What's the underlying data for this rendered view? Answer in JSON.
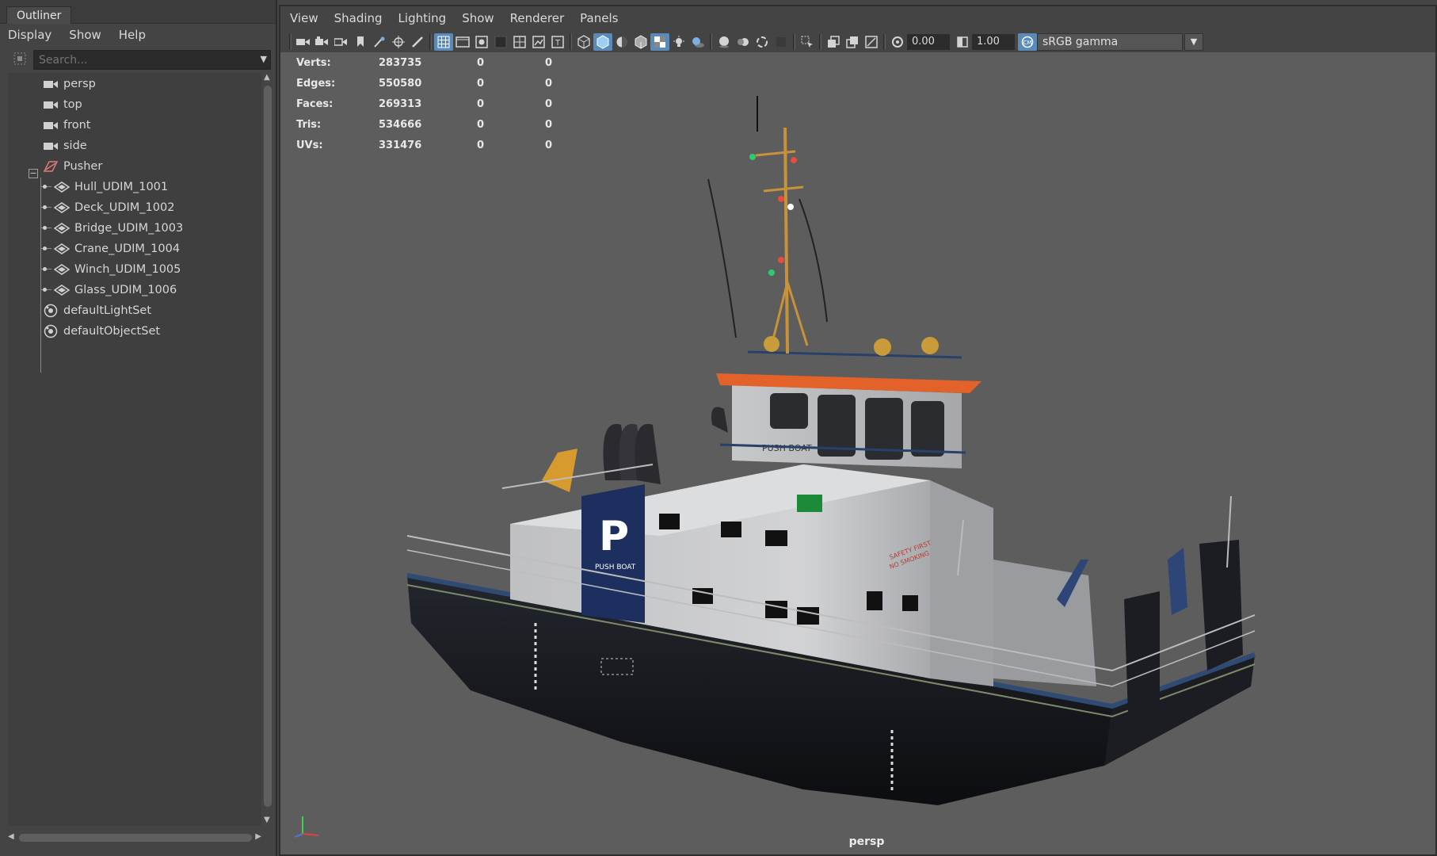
{
  "outliner": {
    "tab_title": "Outliner",
    "menu": [
      "Display",
      "Show",
      "Help"
    ],
    "search_placeholder": "Search...",
    "items": [
      {
        "label": "persp",
        "icon": "camera-icon"
      },
      {
        "label": "top",
        "icon": "camera-icon"
      },
      {
        "label": "front",
        "icon": "camera-icon"
      },
      {
        "label": "side",
        "icon": "camera-icon"
      },
      {
        "label": "Pusher",
        "icon": "group-icon"
      },
      {
        "label": "Hull_UDIM_1001",
        "icon": "mesh-icon"
      },
      {
        "label": "Deck_UDIM_1002",
        "icon": "mesh-icon"
      },
      {
        "label": "Bridge_UDIM_1003",
        "icon": "mesh-icon"
      },
      {
        "label": "Crane_UDIM_1004",
        "icon": "mesh-icon"
      },
      {
        "label": "Winch_UDIM_1005",
        "icon": "mesh-icon"
      },
      {
        "label": "Glass_UDIM_1006",
        "icon": "mesh-icon"
      },
      {
        "label": "defaultLightSet",
        "icon": "set-icon"
      },
      {
        "label": "defaultObjectSet",
        "icon": "set-icon"
      }
    ]
  },
  "panel": {
    "menu": [
      "View",
      "Shading",
      "Lighting",
      "Show",
      "Renderer",
      "Panels"
    ],
    "exposure": "0.00",
    "gamma": "1.00",
    "color_space": "sRGB gamma"
  },
  "hud": {
    "rows": [
      {
        "label": "Verts:",
        "v1": "283735",
        "v2": "0",
        "v3": "0"
      },
      {
        "label": "Edges:",
        "v1": "550580",
        "v2": "0",
        "v3": "0"
      },
      {
        "label": "Faces:",
        "v1": "269313",
        "v2": "0",
        "v3": "0"
      },
      {
        "label": "Tris:",
        "v1": "534666",
        "v2": "0",
        "v3": "0"
      },
      {
        "label": "UVs:",
        "v1": "331476",
        "v2": "0",
        "v3": "0"
      }
    ]
  },
  "viewport": {
    "camera_label": "persp",
    "boat": {
      "bow_letter": "P",
      "bow_text": "PUSH BOAT",
      "bridge_text": "PUSH BOAT",
      "safety_text_1": "SAFETY FIRST",
      "safety_text_2": "NO SMOKING"
    }
  },
  "colors": {
    "viewport_bg": "#5d5d5d",
    "hull": "#15171c",
    "superstructure": "#c9cacc",
    "blue_panel": "#1c2f5e",
    "orange_roof": "#e2622a",
    "crane_yellow": "#d69a2e",
    "highlight": "#5b8ab8"
  }
}
